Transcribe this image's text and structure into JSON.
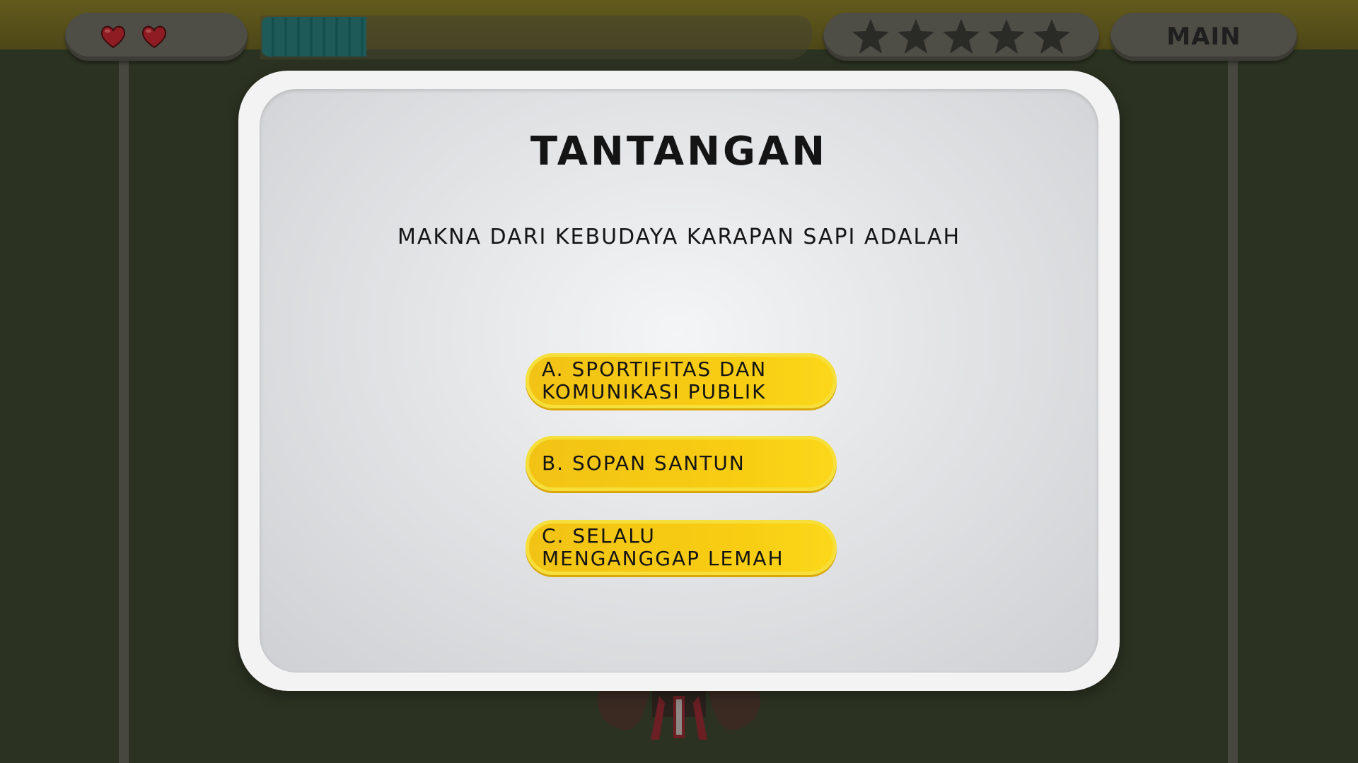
{
  "hud": {
    "lives": 2,
    "lives_icon": "heart-icon",
    "timer_progress": 0.19,
    "stars_total": 5,
    "stars_earned": 0,
    "star_icon": "star-icon",
    "main_label": "MAIN"
  },
  "dialog": {
    "title": "TANTANGAN",
    "question": "MAKNA DARI KEBUDAYA KARAPAN SAPI ADALAH",
    "answers": [
      {
        "label": "A. SPORTIFITAS DAN\nKOMUNIKASI PUBLIK"
      },
      {
        "label": "B. SOPAN SANTUN"
      },
      {
        "label": "C. SELALU\nMENGANGGAP LEMAH"
      }
    ]
  },
  "colors": {
    "answer_button": "#f8cd12",
    "heart": "#8e1c22",
    "timer": "#1d5a58"
  }
}
